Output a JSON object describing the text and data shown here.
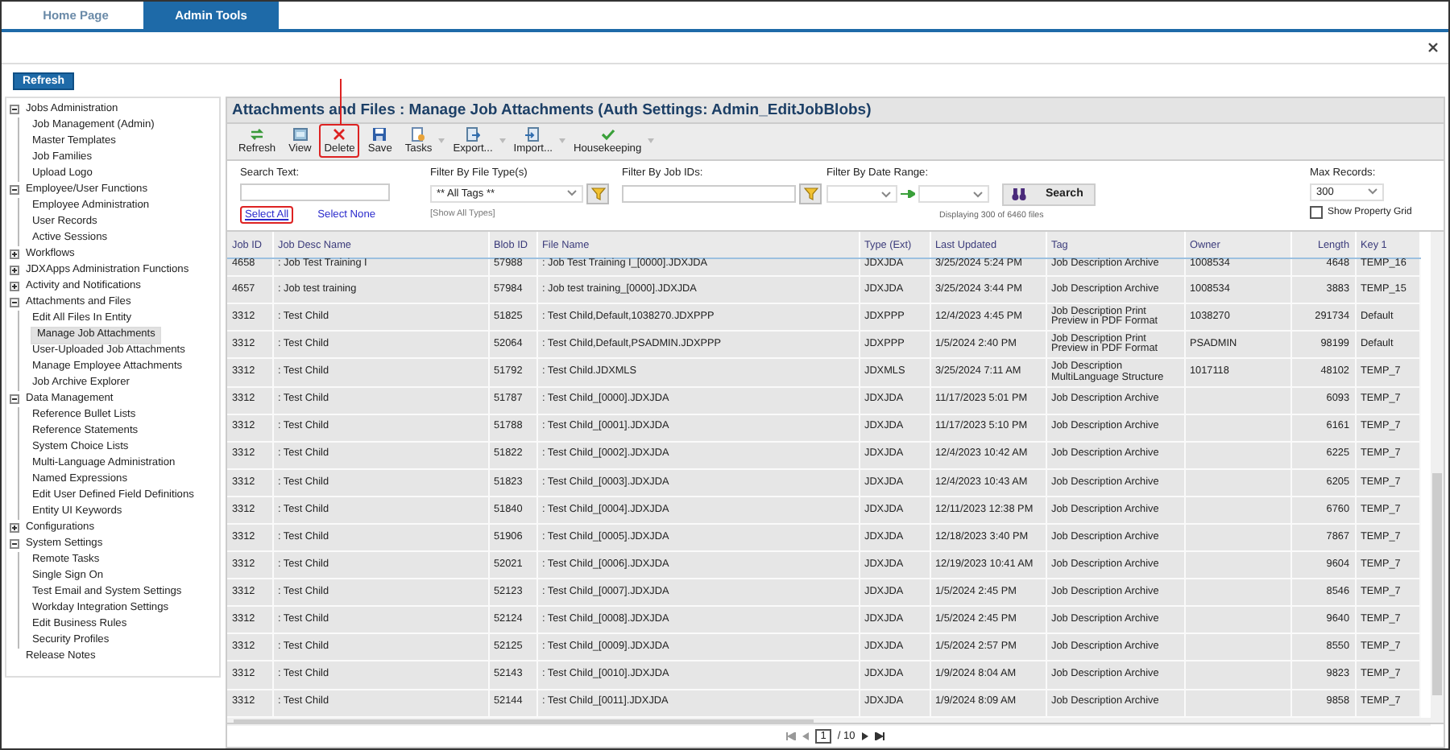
{
  "tabs": [
    {
      "label": "Home Page",
      "selected": false
    },
    {
      "label": "Admin Tools",
      "selected": true
    }
  ],
  "refresh_button": "Refresh",
  "sidebar": {
    "items": [
      {
        "label": "Jobs Administration",
        "expanded": true,
        "selected": false,
        "children": [
          {
            "label": "Job Management (Admin)",
            "selected": false
          },
          {
            "label": "Master Templates",
            "selected": false
          },
          {
            "label": "Job Families",
            "selected": false
          },
          {
            "label": "Upload Logo",
            "selected": false
          }
        ]
      },
      {
        "label": "Employee/User Functions",
        "expanded": true,
        "selected": false,
        "children": [
          {
            "label": "Employee Administration",
            "selected": false
          },
          {
            "label": "User Records",
            "selected": false
          },
          {
            "label": "Active Sessions",
            "selected": false
          }
        ]
      },
      {
        "label": "Workflows",
        "expanded": false,
        "selected": false
      },
      {
        "label": "JDXApps Administration Functions",
        "expanded": false,
        "selected": false
      },
      {
        "label": "Activity and Notifications",
        "expanded": false,
        "selected": false
      },
      {
        "label": "Attachments and Files",
        "expanded": true,
        "selected": false,
        "children": [
          {
            "label": "Edit All Files In Entity",
            "selected": false
          },
          {
            "label": "Manage Job Attachments",
            "selected": true
          },
          {
            "label": "User-Uploaded Job Attachments",
            "selected": false
          },
          {
            "label": "Manage Employee Attachments",
            "selected": false
          },
          {
            "label": "Job Archive Explorer",
            "selected": false
          }
        ]
      },
      {
        "label": "Data Management",
        "expanded": true,
        "selected": false,
        "children": [
          {
            "label": "Reference Bullet Lists",
            "selected": false
          },
          {
            "label": "Reference Statements",
            "selected": false
          },
          {
            "label": "System Choice Lists",
            "selected": false
          },
          {
            "label": "Multi-Language Administration",
            "selected": false
          },
          {
            "label": "Named Expressions",
            "selected": false
          },
          {
            "label": "Edit User Defined Field Definitions",
            "selected": false
          },
          {
            "label": "Entity UI Keywords",
            "selected": false
          }
        ]
      },
      {
        "label": "Configurations",
        "expanded": false,
        "selected": false
      },
      {
        "label": "System Settings",
        "expanded": true,
        "selected": false,
        "children": [
          {
            "label": "Remote Tasks",
            "selected": false
          },
          {
            "label": "Single Sign On",
            "selected": false
          },
          {
            "label": "Test Email and System Settings",
            "selected": false
          },
          {
            "label": "Workday Integration Settings",
            "selected": false
          },
          {
            "label": "Edit Business Rules",
            "selected": false
          },
          {
            "label": "Security Profiles",
            "selected": false
          }
        ]
      },
      {
        "label": "Release Notes",
        "selected": false
      }
    ]
  },
  "panel": {
    "title": "Attachments and Files : Manage Job Attachments (Auth Settings: Admin_EditJobBlobs)",
    "toolbar": [
      {
        "label": "Refresh",
        "kind": "refresh",
        "dropdown": false,
        "highlighted": false
      },
      {
        "label": "View",
        "kind": "view",
        "dropdown": false,
        "highlighted": false
      },
      {
        "label": "Delete",
        "kind": "delete",
        "dropdown": false,
        "highlighted": true
      },
      {
        "label": "Save",
        "kind": "save",
        "dropdown": false,
        "highlighted": false
      },
      {
        "label": "Tasks",
        "kind": "tasks",
        "dropdown": true,
        "highlighted": false
      },
      {
        "label": "Export...",
        "kind": "export",
        "dropdown": true,
        "highlighted": false
      },
      {
        "label": "Import...",
        "kind": "import",
        "dropdown": true,
        "highlighted": false
      },
      {
        "label": "Housekeeping",
        "kind": "check",
        "dropdown": true,
        "highlighted": false
      }
    ],
    "filters": {
      "search_label": "Search Text:",
      "select_links": [
        {
          "label": "Select All",
          "highlighted": true
        },
        {
          "label": "Select None",
          "highlighted": false
        }
      ],
      "file_type_label": "Filter By File Type(s)",
      "file_type_value": "** All Tags **",
      "show_all_types": "[Show All Types]",
      "job_ids_label": "Filter By Job IDs:",
      "date_range_label": "Filter By Date Range:",
      "search_button": "Search",
      "displaying": "Displaying 300 of 6460 files",
      "max_records_label": "Max Records:",
      "max_records_value": "300",
      "show_property_grid": {
        "label": "Show Property Grid",
        "checked": false
      }
    },
    "table": {
      "columns": [
        "Job ID",
        "Job Desc Name",
        "Blob ID",
        "File Name",
        "Type (Ext)",
        "Last Updated",
        "Tag",
        "Owner",
        "Length",
        "Key 1"
      ],
      "rows": [
        [
          "4658",
          ": Job Test Training I",
          "57988",
          ": Job Test Training I_[0000].JDXJDA",
          "JDXJDA",
          "3/25/2024 5:24 PM",
          "Job Description Archive",
          "1008534",
          "4648",
          "TEMP_16"
        ],
        [
          "4657",
          ": Job test training",
          "57984",
          ": Job test training_[0000].JDXJDA",
          "JDXJDA",
          "3/25/2024 3:44 PM",
          "Job Description Archive",
          "1008534",
          "3883",
          "TEMP_15"
        ],
        [
          "3312",
          ": Test Child",
          "51825",
          ": Test Child,Default,1038270.JDXPPP",
          "JDXPPP",
          "12/4/2023 4:45 PM",
          "Job Description Print Preview in PDF Format",
          "1038270",
          "291734",
          "Default"
        ],
        [
          "3312",
          ": Test Child",
          "52064",
          ": Test Child,Default,PSADMIN.JDXPPP",
          "JDXPPP",
          "1/5/2024 2:40 PM",
          "Job Description Print Preview in PDF Format",
          "PSADMIN",
          "98199",
          "Default"
        ],
        [
          "3312",
          ": Test Child",
          "51792",
          ": Test Child.JDXMLS",
          "JDXMLS",
          "3/25/2024 7:11 AM",
          "Job Description MultiLanguage Structure",
          "1017118",
          "48102",
          "TEMP_7"
        ],
        [
          "3312",
          ": Test Child",
          "51787",
          ": Test Child_[0000].JDXJDA",
          "JDXJDA",
          "11/17/2023 5:01 PM",
          "Job Description Archive",
          null,
          "6093",
          "TEMP_7"
        ],
        [
          "3312",
          ": Test Child",
          "51788",
          ": Test Child_[0001].JDXJDA",
          "JDXJDA",
          "11/17/2023 5:10 PM",
          "Job Description Archive",
          null,
          "6161",
          "TEMP_7"
        ],
        [
          "3312",
          ": Test Child",
          "51822",
          ": Test Child_[0002].JDXJDA",
          "JDXJDA",
          "12/4/2023 10:42 AM",
          "Job Description Archive",
          null,
          "6225",
          "TEMP_7"
        ],
        [
          "3312",
          ": Test Child",
          "51823",
          ": Test Child_[0003].JDXJDA",
          "JDXJDA",
          "12/4/2023 10:43 AM",
          "Job Description Archive",
          null,
          "6205",
          "TEMP_7"
        ],
        [
          "3312",
          ": Test Child",
          "51840",
          ": Test Child_[0004].JDXJDA",
          "JDXJDA",
          "12/11/2023 12:38 PM",
          "Job Description Archive",
          null,
          "6760",
          "TEMP_7"
        ],
        [
          "3312",
          ": Test Child",
          "51906",
          ": Test Child_[0005].JDXJDA",
          "JDXJDA",
          "12/18/2023 3:40 PM",
          "Job Description Archive",
          null,
          "7867",
          "TEMP_7"
        ],
        [
          "3312",
          ": Test Child",
          "52021",
          ": Test Child_[0006].JDXJDA",
          "JDXJDA",
          "12/19/2023 10:41 AM",
          "Job Description Archive",
          null,
          "9604",
          "TEMP_7"
        ],
        [
          "3312",
          ": Test Child",
          "52123",
          ": Test Child_[0007].JDXJDA",
          "JDXJDA",
          "1/5/2024 2:45 PM",
          "Job Description Archive",
          null,
          "8546",
          "TEMP_7"
        ],
        [
          "3312",
          ": Test Child",
          "52124",
          ": Test Child_[0008].JDXJDA",
          "JDXJDA",
          "1/5/2024 2:45 PM",
          "Job Description Archive",
          null,
          "9640",
          "TEMP_7"
        ],
        [
          "3312",
          ": Test Child",
          "52125",
          ": Test Child_[0009].JDXJDA",
          "JDXJDA",
          "1/5/2024 2:57 PM",
          "Job Description Archive",
          null,
          "8550",
          "TEMP_7"
        ],
        [
          "3312",
          ": Test Child",
          "52143",
          ": Test Child_[0010].JDXJDA",
          "JDXJDA",
          "1/9/2024 8:04 AM",
          "Job Description Archive",
          null,
          "9823",
          "TEMP_7"
        ],
        [
          "3312",
          ": Test Child",
          "52144",
          ": Test Child_[0011].JDXJDA",
          "JDXJDA",
          "1/9/2024 8:09 AM",
          "Job Description Archive",
          null,
          "9858",
          "TEMP_7"
        ]
      ]
    },
    "pager": {
      "page": "1",
      "total": "/ 10"
    }
  }
}
